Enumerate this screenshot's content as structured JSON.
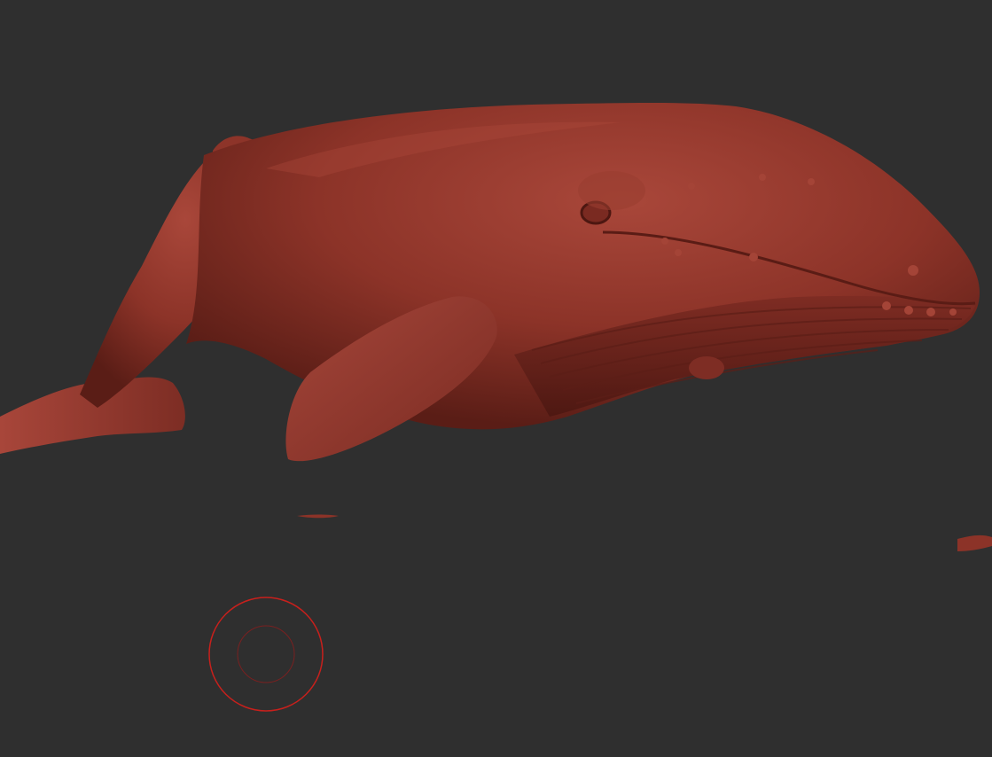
{
  "viewport": {
    "background_color": "#2f2f2f"
  },
  "model": {
    "material_color": "#8c3328",
    "highlight_color": "#b34a3b",
    "shadow_color": "#5a1d16"
  },
  "brush_cursor": {
    "stroke_color": "#c8201c",
    "icon": "brush-cursor-icon"
  }
}
